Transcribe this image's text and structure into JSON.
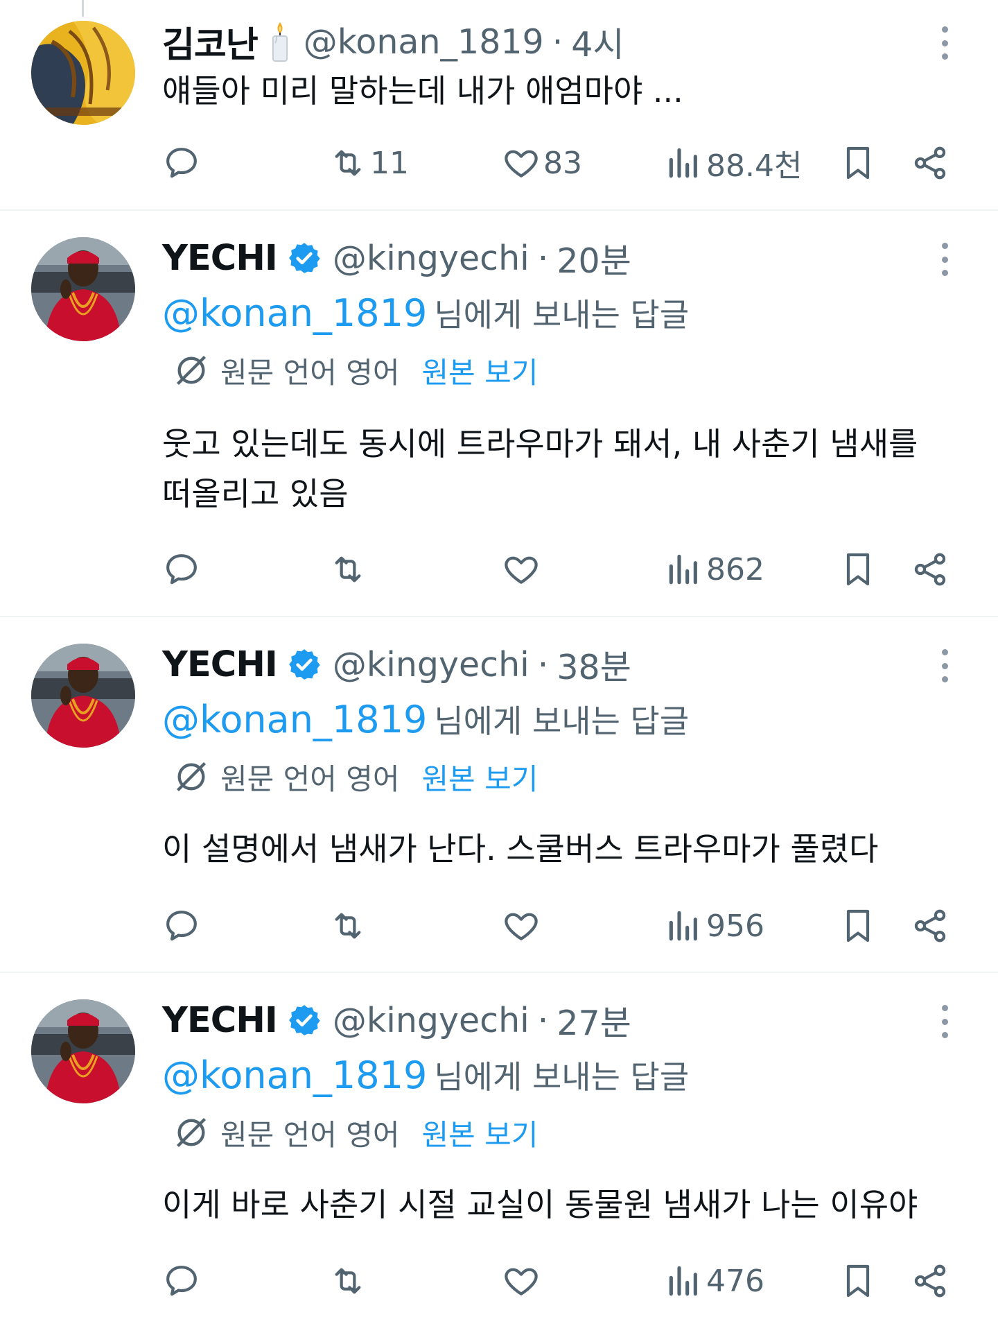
{
  "tweets": [
    {
      "name": "김코난",
      "handle": "@konan_1819",
      "time": "4시",
      "text": "얘들아 미리 말하는데 내가 애엄마야 ...",
      "retweets": "11",
      "likes": "83",
      "views": "88.4천",
      "avatar_icon": "cartoon-avatar",
      "badge_icon": "candle-icon"
    },
    {
      "name": "YECHI",
      "handle": "@kingyechi",
      "time": "20분",
      "reply_to": "@konan_1819",
      "reply_suffix": "님에게 보내는 답글",
      "translate_label": "원문 언어 영어",
      "translate_link": "원본 보기",
      "text": "웃고 있는데도 동시에 트라우마가 돼서, 내 사춘기 냄새를 떠올리고 있음",
      "retweets": "",
      "likes": "",
      "views": "862",
      "badge_icon": "verified-icon"
    },
    {
      "name": "YECHI",
      "handle": "@kingyechi",
      "time": "38분",
      "reply_to": "@konan_1819",
      "reply_suffix": "님에게 보내는 답글",
      "translate_label": "원문 언어 영어",
      "translate_link": "원본 보기",
      "text": "이 설명에서 냄새가 난다. 스쿨버스 트라우마가 풀렸다",
      "retweets": "",
      "likes": "",
      "views": "956",
      "badge_icon": "verified-icon"
    },
    {
      "name": "YECHI",
      "handle": "@kingyechi",
      "time": "27분",
      "reply_to": "@konan_1819",
      "reply_suffix": "님에게 보내는 답글",
      "translate_label": "원문 언어 영어",
      "translate_link": "원본 보기",
      "text": "이게 바로 사춘기 시절 교실이 동물원 냄새가 나는 이유야",
      "retweets": "",
      "likes": "",
      "views": "476",
      "badge_icon": "verified-icon"
    }
  ],
  "colors": {
    "accent": "#1d9bf0",
    "secondary_text": "#536471",
    "divider": "#eff3f4"
  }
}
